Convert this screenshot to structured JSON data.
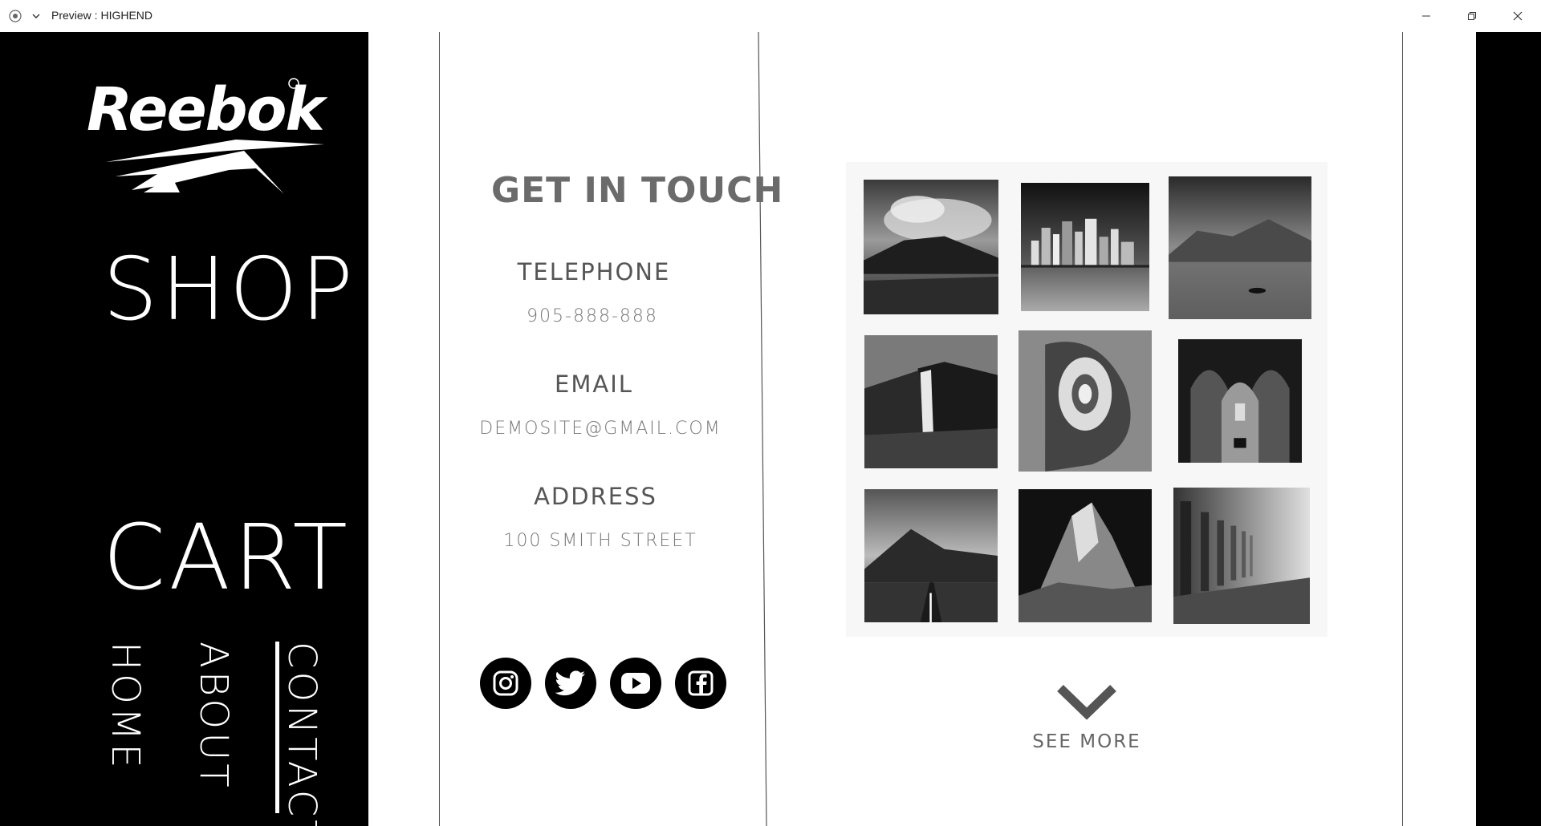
{
  "window": {
    "title": "Preview : HIGHEND"
  },
  "brand": {
    "logo": "reebok-logo"
  },
  "nav": {
    "shop": "SHOP",
    "cart": "CART",
    "home": "HOME",
    "about": "ABOUT",
    "contact": "CONTACT",
    "active": "CONTACT"
  },
  "contact": {
    "title": "GET IN TOUCH",
    "telephone_label": "TELEPHONE",
    "telephone_value": "905-888-888",
    "email_label": "EMAIL",
    "email_value": "DEMOSITE@GMAIL.COM",
    "address_label": "ADDRESS",
    "address_value": "100 SMITH STREET"
  },
  "socials": [
    {
      "name": "instagram-icon"
    },
    {
      "name": "twitter-icon"
    },
    {
      "name": "youtube-icon"
    },
    {
      "name": "facebook-icon"
    }
  ],
  "gallery": {
    "photos": [
      "volcano-clouds-photo",
      "city-skyline-photo",
      "misty-lake-photo",
      "waterfall-cliff-photo",
      "spiral-sculpture-photo",
      "gothic-arches-photo",
      "mountain-road-photo",
      "rocky-peak-photo",
      "colonnade-photo"
    ],
    "see_more": "SEE MORE"
  },
  "colors": {
    "sidebar_bg": "#000000",
    "canvas_bg": "#ffffff",
    "heading": "#6b6b6b",
    "text": "#555555"
  }
}
